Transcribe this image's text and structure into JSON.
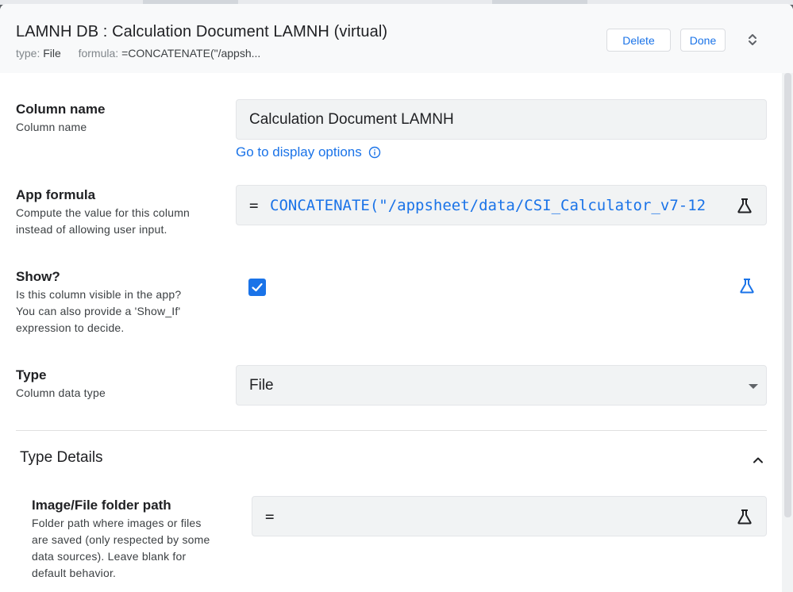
{
  "header": {
    "title": "LAMNH DB : Calculation Document LAMNH (virtual)",
    "type_label": "type:",
    "type_value": "File",
    "formula_label": "formula:",
    "formula_value": "=CONCATENATE(\"/appsh...",
    "delete_label": "Delete",
    "done_label": "Done"
  },
  "column_name": {
    "label": "Column name",
    "description": "Column name",
    "value": "Calculation Document LAMNH",
    "display_link": "Go to display options"
  },
  "app_formula": {
    "label": "App formula",
    "description_line1": "Compute the value for this column",
    "description_line2": "instead of allowing user input.",
    "eq": "=",
    "value": "CONCATENATE(\"/appsheet/data/CSI_Calculator_v7-12"
  },
  "show": {
    "label": "Show?",
    "description_line1": "Is this column visible in the app?",
    "description_line2": "You can also provide a 'Show_If'",
    "description_line3": "expression to decide.",
    "checked": true
  },
  "type": {
    "label": "Type",
    "description": "Column data type",
    "value": "File"
  },
  "type_details": {
    "title": "Type Details",
    "folder_path": {
      "label": "Image/File folder path",
      "description_line1": "Folder path where images or files",
      "description_line2": "are saved (only respected by some",
      "description_line3": "data sources). Leave blank for",
      "description_line4": "default behavior.",
      "eq": "="
    }
  },
  "colors": {
    "accent": "#1a73e8",
    "field_bg": "#f1f3f4",
    "header_bg": "#f8f9fa"
  }
}
